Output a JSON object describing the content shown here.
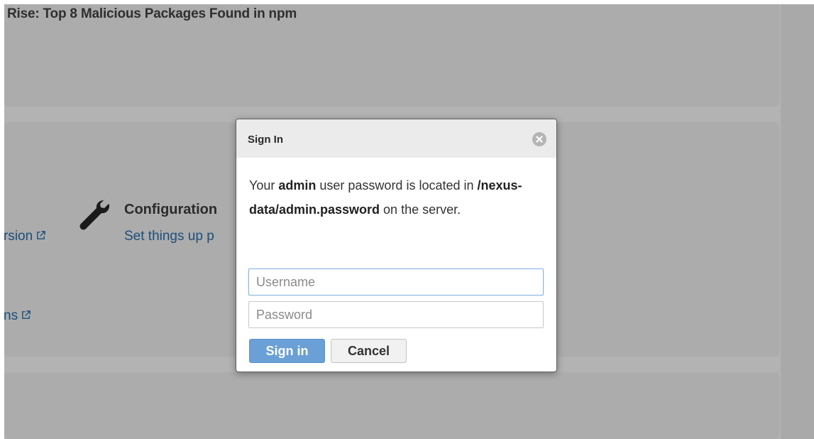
{
  "background": {
    "news_title": "Rise: Top 8 Malicious Packages Found in npm",
    "link_fragment_1": "rsion",
    "link_fragment_2": "ns",
    "config_title": "Configuration",
    "config_subtitle": "Set things up p"
  },
  "modal": {
    "title": "Sign In",
    "message_prefix": "Your ",
    "message_user": "admin",
    "message_mid": " user password is located in ",
    "message_path": "/nexus-data/admin.password",
    "message_suffix": " on the server.",
    "username_placeholder": "Username",
    "password_placeholder": "Password",
    "signin_label": "Sign in",
    "cancel_label": "Cancel"
  },
  "icons": {
    "close": "close-circle-icon",
    "wrench": "wrench-icon",
    "external_link": "external-link-icon"
  },
  "colors": {
    "primary_button": "#6aa0d6",
    "link": "#1c4e7c",
    "overlay": "#b3b3b3"
  }
}
